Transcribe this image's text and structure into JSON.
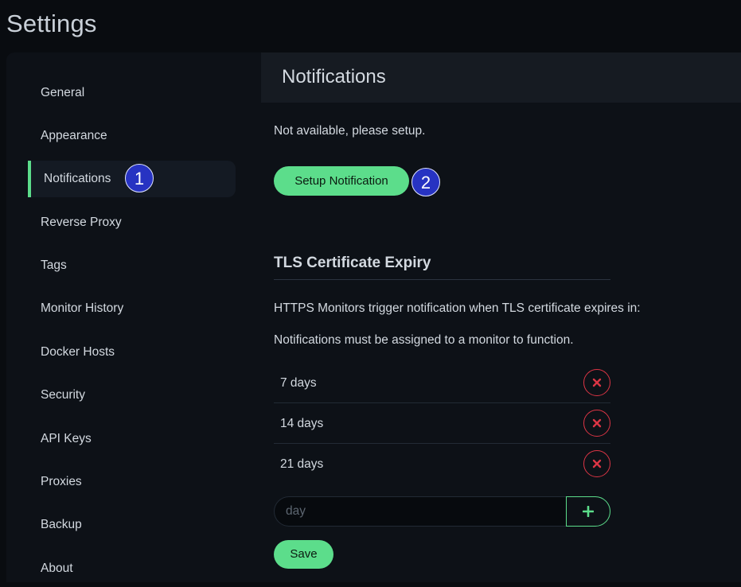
{
  "page": {
    "title": "Settings"
  },
  "sidebar": {
    "items": [
      {
        "label": "General"
      },
      {
        "label": "Appearance"
      },
      {
        "label": "Notifications",
        "active": true
      },
      {
        "label": "Reverse Proxy"
      },
      {
        "label": "Tags"
      },
      {
        "label": "Monitor History"
      },
      {
        "label": "Docker Hosts"
      },
      {
        "label": "Security"
      },
      {
        "label": "API Keys"
      },
      {
        "label": "Proxies"
      },
      {
        "label": "Backup"
      },
      {
        "label": "About"
      }
    ]
  },
  "annotations": {
    "badge_1": "1",
    "badge_2": "2"
  },
  "notifications": {
    "header": "Notifications",
    "empty_message": "Not available, please setup.",
    "setup_button": "Setup Notification"
  },
  "tls": {
    "title": "TLS Certificate Expiry",
    "description": "HTTPS Monitors trigger notification when TLS certificate expires in:",
    "note": "Notifications must be assigned to a monitor to function.",
    "days": [
      "7 days",
      "14 days",
      "21 days"
    ],
    "input_placeholder": "day",
    "input_value": "",
    "save_button": "Save"
  },
  "colors": {
    "accent": "#5cdd8b",
    "danger": "#dc3545",
    "badge": "#2733c2",
    "background": "#0d1117"
  },
  "icons": {
    "remove": "x-icon",
    "add": "plus-icon"
  }
}
